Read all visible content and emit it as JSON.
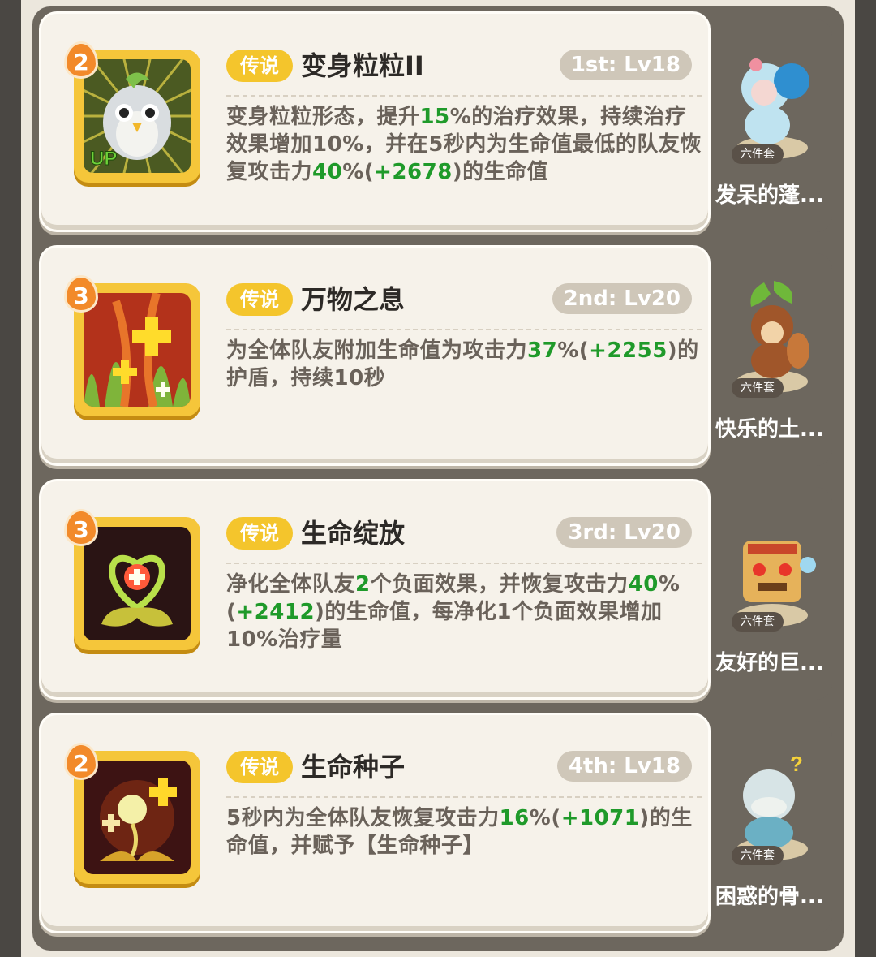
{
  "badge_label": "传说",
  "set_label": "六件套",
  "skills": [
    {
      "level": "2",
      "name": "变身粒粒II",
      "rank": "1st: Lv18",
      "up_tag": "UP",
      "desc_parts": [
        {
          "t": "变身粒粒形态，提升"
        },
        {
          "t": "15",
          "g": true
        },
        {
          "t": "%的治疗效果，持续治疗效果增加10%，并在5秒内为生命值最低的队友恢复攻击力"
        },
        {
          "t": "40",
          "g": true
        },
        {
          "t": "%("
        },
        {
          "t": "+2678",
          "g": true
        },
        {
          "t": ")的生命值"
        }
      ],
      "pet_name": "发呆的蓬...",
      "colors": {
        "art": "#3a4a1e",
        "accent": "#a6d46a"
      }
    },
    {
      "level": "3",
      "name": "万物之息",
      "rank": "2nd: Lv20",
      "desc_parts": [
        {
          "t": "为全体队友附加生命值为攻击力"
        },
        {
          "t": "37",
          "g": true
        },
        {
          "t": "%("
        },
        {
          "t": "+2255",
          "g": true
        },
        {
          "t": ")的护盾，持续10秒"
        }
      ],
      "pet_name": "快乐的土...",
      "colors": {
        "art": "#b1321c",
        "accent": "#ffd42a"
      }
    },
    {
      "level": "3",
      "name": "生命绽放",
      "rank": "3rd: Lv20",
      "desc_parts": [
        {
          "t": "净化全体队友"
        },
        {
          "t": "2",
          "g": true
        },
        {
          "t": "个负面效果，并恢复攻击力"
        },
        {
          "t": "40",
          "g": true
        },
        {
          "t": "%("
        },
        {
          "t": "+2412",
          "g": true
        },
        {
          "t": ")的生命值，每净化1个负面效果增加10%治疗量"
        }
      ],
      "pet_name": "友好的巨...",
      "colors": {
        "art": "#2b1616",
        "accent": "#bde05a"
      }
    },
    {
      "level": "2",
      "name": "生命种子",
      "rank": "4th: Lv18",
      "desc_parts": [
        {
          "t": "5秒内为全体队友恢复攻击力"
        },
        {
          "t": "16",
          "g": true
        },
        {
          "t": "%("
        },
        {
          "t": "+1071",
          "g": true
        },
        {
          "t": ")的生命值，并赋予【生命种子】"
        }
      ],
      "pet_name": "困惑的骨...",
      "colors": {
        "art": "#3a1212",
        "accent": "#ffe070"
      }
    }
  ]
}
